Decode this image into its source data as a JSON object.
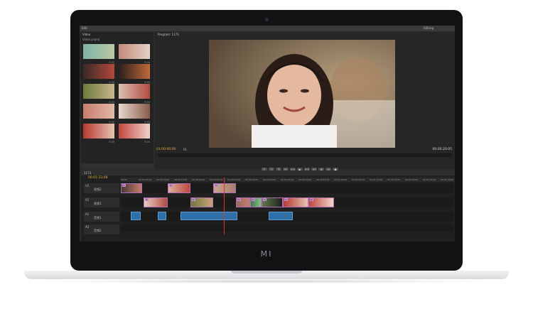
{
  "screen": {
    "topbar": {
      "left_label": "Edit",
      "right_label": "Editing"
    },
    "project_panel": {
      "tab_label": "Video",
      "subtitle": "Video.prproj",
      "thumbs": [
        {
          "duration": "5:05"
        },
        {
          "duration": "5:00"
        },
        {
          "duration": "5:00"
        },
        {
          "duration": "5:00"
        },
        {
          "duration": "5:00"
        },
        {
          "duration": "5:00"
        },
        {
          "duration": "5:00"
        },
        {
          "duration": "5:00"
        },
        {
          "duration": "5:00"
        },
        {
          "duration": "5:00"
        }
      ]
    },
    "program_monitor": {
      "title": "Program: 1173",
      "timecode_current": "01:00:00:00",
      "fit_label": "Fit",
      "timecode_total": "00:00:20:05",
      "transport": [
        "|{",
        "}|",
        "{|",
        "|<",
        "<<",
        "▶",
        ">>",
        ">|",
        "⊞",
        "⊟",
        "▣"
      ]
    },
    "timeline": {
      "title": "1173",
      "timecode": "00:01:33:08",
      "ruler": [
        "00:00",
        "00:00:05:00",
        "00:00:10:00",
        "00:00:15:00",
        "00:00:20:00",
        "00:00:25:00",
        "00:00:30:00",
        "00:00:35:00",
        "00:00:40:00",
        "00:00:45:00",
        "00:00:50:00",
        "00:00:55:00",
        "00:01:00:00",
        "00:01:05:00",
        "00:01:10:00",
        "00:01:15:00",
        "00:01:20:00",
        "00:01:25:00",
        "00:01:30:00"
      ],
      "tracks": [
        {
          "name": "V2",
          "label": "视频2"
        },
        {
          "name": "V1",
          "label": "视频1"
        },
        {
          "name": "A1",
          "label": "音频1"
        },
        {
          "name": "A2",
          "label": "音频2"
        }
      ],
      "clips_v2_labels": [
        "fx",
        "fx",
        "fx"
      ],
      "clips_v1_labels": [
        "fx",
        "fx",
        "fx",
        "fx",
        "fx",
        "fx",
        "fx"
      ]
    }
  },
  "logo": "MI"
}
